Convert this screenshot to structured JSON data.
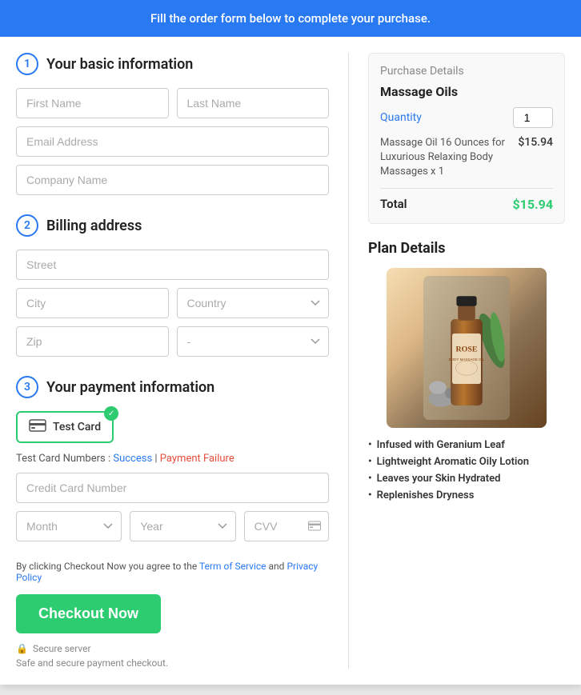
{
  "banner": {
    "text": "Fill the order form below to complete your purchase."
  },
  "form": {
    "section1": {
      "number": "1",
      "title": "Your basic information",
      "fields": {
        "first_name_placeholder": "First Name",
        "last_name_placeholder": "Last Name",
        "email_placeholder": "Email Address",
        "company_placeholder": "Company Name"
      }
    },
    "section2": {
      "number": "2",
      "title": "Billing address",
      "fields": {
        "street_placeholder": "Street",
        "city_placeholder": "City",
        "country_placeholder": "Country",
        "zip_placeholder": "Zip",
        "state_placeholder": "-"
      }
    },
    "section3": {
      "number": "3",
      "title": "Your payment information",
      "card_label": "Test Card",
      "test_card_hint": "Test Card Numbers :",
      "test_card_success": "Success",
      "test_card_separator": " | ",
      "test_card_failure": "Payment Failure",
      "cc_placeholder": "Credit Card Number",
      "month_placeholder": "Month",
      "year_placeholder": "Year",
      "cvv_placeholder": "CVV"
    },
    "terms": {
      "prefix": "By clicking Checkout Now you agree to the ",
      "tos_label": "Term of Service",
      "middle": " and ",
      "privacy_label": "Privacy Policy"
    },
    "checkout_btn": "Checkout Now",
    "secure_label": "Secure server",
    "secure_desc": "Safe and secure payment checkout."
  },
  "purchase_details": {
    "title": "Purchase Details",
    "product_name": "Massage Oils",
    "quantity_label": "Quantity",
    "quantity_value": "1",
    "product_desc": "Massage Oil 16 Ounces for Luxurious Relaxing Body Massages x 1",
    "product_price": "$15.94",
    "total_label": "Total",
    "total_amount": "$15.94"
  },
  "plan_details": {
    "title": "Plan Details",
    "features": [
      "Infused with Geranium Leaf",
      "Lightweight Aromatic Oily Lotion",
      "Leaves your Skin Hydrated",
      "Replenishes Dryness"
    ]
  }
}
